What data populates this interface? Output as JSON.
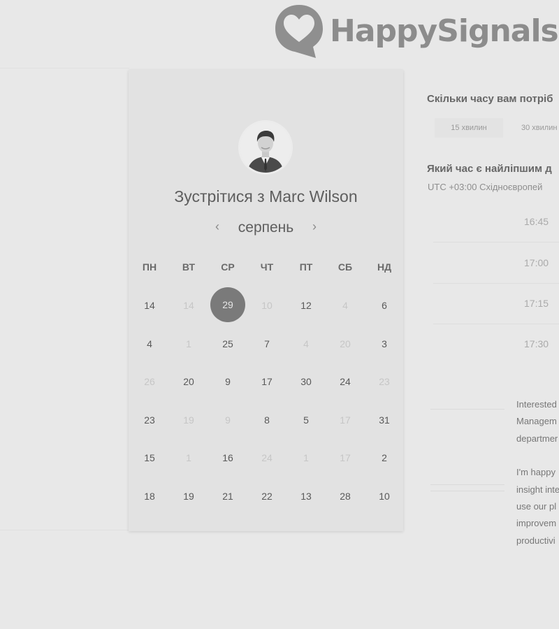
{
  "header": {
    "logo_text": "HappySignals"
  },
  "calendar": {
    "title": "Зустрітися з Marc Wilson",
    "month": "серпень",
    "prev_icon": "‹",
    "next_icon": "›",
    "weekdays": [
      "ПН",
      "ВТ",
      "СР",
      "ЧТ",
      "ПТ",
      "СБ",
      "НД"
    ],
    "rows": [
      [
        {
          "d": "14"
        },
        {
          "d": "14",
          "muted": true
        },
        {
          "d": "29",
          "selected": true
        },
        {
          "d": "10",
          "muted": true
        },
        {
          "d": "12"
        },
        {
          "d": "4",
          "muted": true
        },
        {
          "d": "6"
        }
      ],
      [
        {
          "d": "4"
        },
        {
          "d": "1",
          "muted": true
        },
        {
          "d": "25"
        },
        {
          "d": "7"
        },
        {
          "d": "4",
          "muted": true
        },
        {
          "d": "20",
          "muted": true
        },
        {
          "d": "3"
        }
      ],
      [
        {
          "d": "26",
          "muted": true
        },
        {
          "d": "20"
        },
        {
          "d": "9"
        },
        {
          "d": "17"
        },
        {
          "d": "30"
        },
        {
          "d": "24"
        },
        {
          "d": "23",
          "muted": true
        }
      ],
      [
        {
          "d": "23"
        },
        {
          "d": "19",
          "muted": true
        },
        {
          "d": "9",
          "muted": true
        },
        {
          "d": "8"
        },
        {
          "d": "5"
        },
        {
          "d": "17",
          "muted": true
        },
        {
          "d": "31"
        }
      ],
      [
        {
          "d": "15"
        },
        {
          "d": "1",
          "muted": true
        },
        {
          "d": "16"
        },
        {
          "d": "24",
          "muted": true
        },
        {
          "d": "1",
          "muted": true
        },
        {
          "d": "17",
          "muted": true
        },
        {
          "d": "2"
        }
      ],
      [
        {
          "d": "18"
        },
        {
          "d": "19"
        },
        {
          "d": "21"
        },
        {
          "d": "22"
        },
        {
          "d": "13"
        },
        {
          "d": "28"
        },
        {
          "d": "10"
        }
      ]
    ]
  },
  "booking": {
    "duration_question": "Скільки часу вам потріб",
    "durations": [
      "15 хвилин",
      "30 хвилин"
    ],
    "time_question": "Який час є найліпшим д",
    "timezone": "UTC +03:00 Східноєвропей",
    "slots": [
      "16:45",
      "17:00",
      "17:15",
      "17:30"
    ]
  },
  "description": {
    "lines1": [
      "Interested",
      "Managem",
      "departmer"
    ],
    "lines2": [
      "I'm happy",
      "insight inte",
      "use our pl",
      "improvem",
      "productivi"
    ]
  },
  "colors": {
    "selected_day": "#7a7a7a",
    "card_bg": "#e2e2e2",
    "page_bg": "#e8e8e8"
  }
}
